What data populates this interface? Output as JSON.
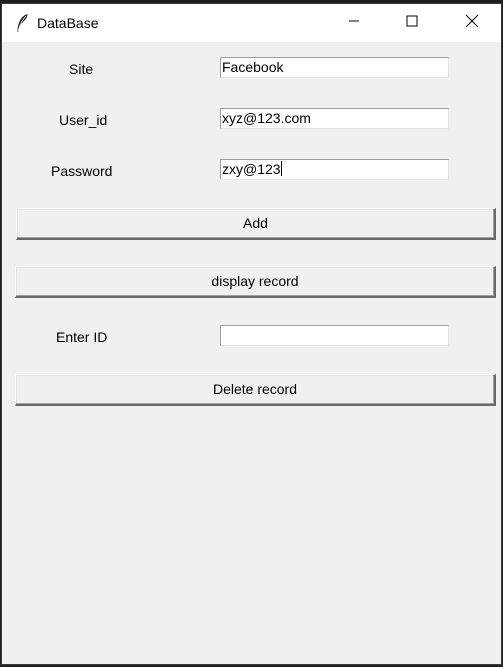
{
  "window": {
    "title": "DataBase",
    "icon": "feather-icon"
  },
  "controls": {
    "minimize": "minimize-icon",
    "maximize": "maximize-icon",
    "close": "close-icon"
  },
  "form": {
    "site_label": "Site",
    "site_value": "Facebook",
    "user_label": "User_id",
    "user_value": "xyz@123.com",
    "password_label": "Password",
    "password_value": "zxy@123",
    "add_label": "Add",
    "display_label": "display record",
    "enter_id_label": "Enter ID",
    "enter_id_value": "",
    "delete_label": "Delete record"
  }
}
